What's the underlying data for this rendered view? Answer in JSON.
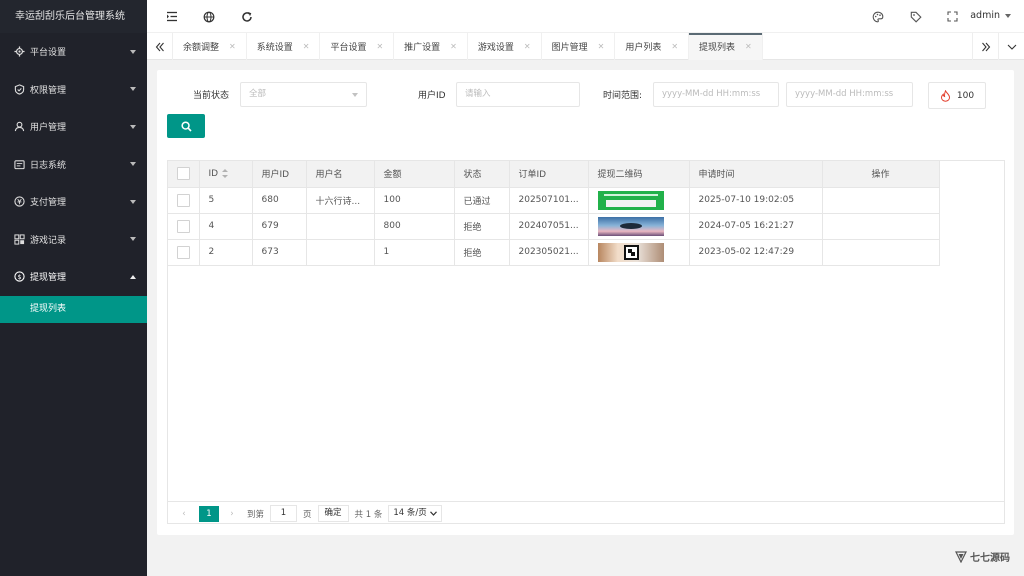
{
  "app": {
    "title": "幸运刮刮乐后台管理系统"
  },
  "sidebar": {
    "items": [
      {
        "label": "平台设置",
        "icon": "gear-icon"
      },
      {
        "label": "权限管理",
        "icon": "shield-icon"
      },
      {
        "label": "用户管理",
        "icon": "user-icon"
      },
      {
        "label": "日志系统",
        "icon": "log-icon"
      },
      {
        "label": "支付管理",
        "icon": "payment-icon"
      },
      {
        "label": "游戏记录",
        "icon": "game-record-icon"
      },
      {
        "label": "提现管理",
        "icon": "dollar-icon"
      }
    ],
    "active_child": "提现列表"
  },
  "header": {
    "user": "admin"
  },
  "tabs": [
    {
      "label": "余额调整"
    },
    {
      "label": "系统设置"
    },
    {
      "label": "平台设置"
    },
    {
      "label": "推广设置"
    },
    {
      "label": "游戏设置"
    },
    {
      "label": "图片管理"
    },
    {
      "label": "用户列表"
    },
    {
      "label": "提现列表",
      "active": true
    }
  ],
  "filters": {
    "status_label": "当前状态",
    "status_value": "全部",
    "uid_label": "用户ID",
    "uid_placeholder": "请输入",
    "time_label": "时间范围:",
    "time_start_placeholder": "yyyy-MM-dd HH:mm:ss",
    "time_end_placeholder": "yyyy-MM-dd HH:mm:ss",
    "fire_count": "100"
  },
  "table": {
    "columns": [
      "ID",
      "用户ID",
      "用户名",
      "金额",
      "状态",
      "订单ID",
      "提现二维码",
      "申请时间",
      "操作"
    ],
    "rows": [
      {
        "id": "5",
        "uid": "680",
        "username": "十六行诗...",
        "amount": "100",
        "status": "已通过",
        "order_id": "202507101...",
        "qr": "qr1",
        "qr_text": "微信支付收款码",
        "time": "2025-07-10 19:02:05"
      },
      {
        "id": "4",
        "uid": "679",
        "username": "",
        "amount": "800",
        "status": "拒绝",
        "order_id": "202407051...",
        "qr": "qr2",
        "qr_text": "",
        "time": "2024-07-05 16:21:27"
      },
      {
        "id": "2",
        "uid": "673",
        "username": "",
        "amount": "1",
        "status": "拒绝",
        "order_id": "202305021...",
        "qr": "qr3",
        "qr_text": "",
        "time": "2023-05-02 12:47:29"
      }
    ]
  },
  "pager": {
    "current": "1",
    "goto_label": "到第",
    "goto_value": "1",
    "page_unit": "页",
    "confirm": "确定",
    "total": "共 1 条",
    "page_size": "14 条/页"
  },
  "watermark": {
    "text": "七七源码"
  },
  "colors": {
    "accent": "#009688",
    "sidebar_bg": "#20222a"
  }
}
